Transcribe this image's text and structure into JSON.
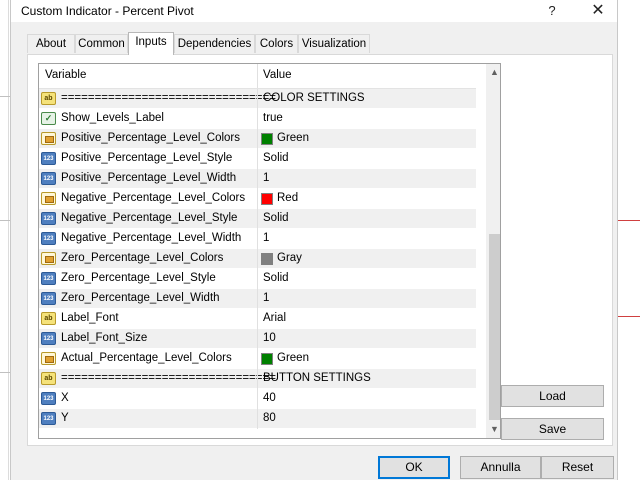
{
  "window": {
    "title": "Custom Indicator - Percent Pivot",
    "help": "?",
    "close": "✕"
  },
  "tabs": [
    {
      "label": "About"
    },
    {
      "label": "Common"
    },
    {
      "label": "Inputs"
    },
    {
      "label": "Dependencies"
    },
    {
      "label": "Colors"
    },
    {
      "label": "Visualization"
    }
  ],
  "active_tab": "Inputs",
  "grid": {
    "headers": {
      "variable": "Variable",
      "value": "Value"
    },
    "rows": [
      {
        "icon": "string-icon",
        "variable": "================================",
        "value": "COLOR SETTINGS"
      },
      {
        "icon": "bool-icon",
        "variable": "Show_Levels_Label",
        "value": "true"
      },
      {
        "icon": "color-icon",
        "variable": "Positive_Percentage_Level_Colors",
        "value": "Green",
        "swatch": "#008000"
      },
      {
        "icon": "number-icon",
        "variable": "Positive_Percentage_Level_Style",
        "value": "Solid"
      },
      {
        "icon": "number-icon",
        "variable": "Positive_Percentage_Level_Width",
        "value": "1"
      },
      {
        "icon": "color-icon",
        "variable": "Negative_Percentage_Level_Colors",
        "value": "Red",
        "swatch": "#ff0000"
      },
      {
        "icon": "number-icon",
        "variable": "Negative_Percentage_Level_Style",
        "value": "Solid"
      },
      {
        "icon": "number-icon",
        "variable": "Negative_Percentage_Level_Width",
        "value": "1"
      },
      {
        "icon": "color-icon",
        "variable": "Zero_Percentage_Level_Colors",
        "value": "Gray",
        "swatch": "#808080"
      },
      {
        "icon": "number-icon",
        "variable": "Zero_Percentage_Level_Style",
        "value": "Solid"
      },
      {
        "icon": "number-icon",
        "variable": "Zero_Percentage_Level_Width",
        "value": "1"
      },
      {
        "icon": "string-icon",
        "variable": "Label_Font",
        "value": "Arial"
      },
      {
        "icon": "number-icon",
        "variable": "Label_Font_Size",
        "value": "10"
      },
      {
        "icon": "color-icon",
        "variable": "Actual_Percentage_Level_Colors",
        "value": "Green",
        "swatch": "#008000"
      },
      {
        "icon": "string-icon",
        "variable": "================================",
        "value": "BUTTON SETTINGS"
      },
      {
        "icon": "number-icon",
        "variable": "X",
        "value": "40"
      },
      {
        "icon": "number-icon",
        "variable": "Y",
        "value": "80"
      }
    ]
  },
  "side_buttons": {
    "load": "Load",
    "save": "Save"
  },
  "bottom_buttons": {
    "ok": "OK",
    "cancel": "Annulla",
    "reset": "Reset"
  },
  "icon_glyphs": {
    "string-icon": "ab",
    "number-icon": "123",
    "bool-icon": "✓"
  },
  "colors": {
    "accent_focus": "#0078d7",
    "green": "#008000",
    "red": "#ff0000",
    "gray": "#808080"
  }
}
